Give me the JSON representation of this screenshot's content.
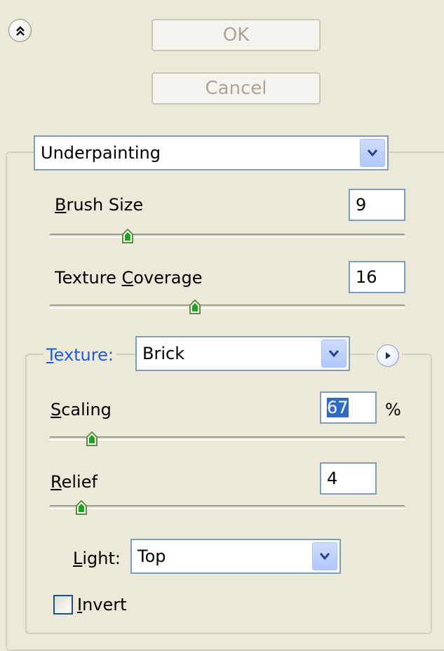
{
  "buttons": {
    "ok": "OK",
    "cancel": "Cancel"
  },
  "filter": {
    "selected": "Underpainting"
  },
  "brush_size": {
    "label_mnemonic": "B",
    "label_rest": "rush Size",
    "value": "9",
    "slider_fraction": 0.22
  },
  "texture_coverage": {
    "label_pre": "Texture ",
    "label_mnemonic": "C",
    "label_rest": "overage",
    "value": "16",
    "slider_fraction": 0.41
  },
  "texture": {
    "label_mnemonic": "T",
    "label_rest": "exture:",
    "selected": "Brick"
  },
  "scaling": {
    "label_mnemonic": "S",
    "label_rest": "caling",
    "value": "67",
    "unit": "%",
    "slider_fraction": 0.12
  },
  "relief": {
    "label_mnemonic": "R",
    "label_rest": "elief",
    "value": "4",
    "slider_fraction": 0.09
  },
  "light": {
    "label_mnemonic": "L",
    "label_rest": "ight:",
    "selected": "Top"
  },
  "invert": {
    "label_mnemonic": "I",
    "label_rest": "nvert",
    "checked": false
  },
  "icons": {
    "collapse": "double-chevron-up-icon",
    "dropdown": "chevron-down-icon",
    "expand": "play-icon"
  },
  "colors": {
    "panel_bg": "#ece9d8",
    "accent": "#316ac5",
    "link": "#1f5bd8"
  }
}
